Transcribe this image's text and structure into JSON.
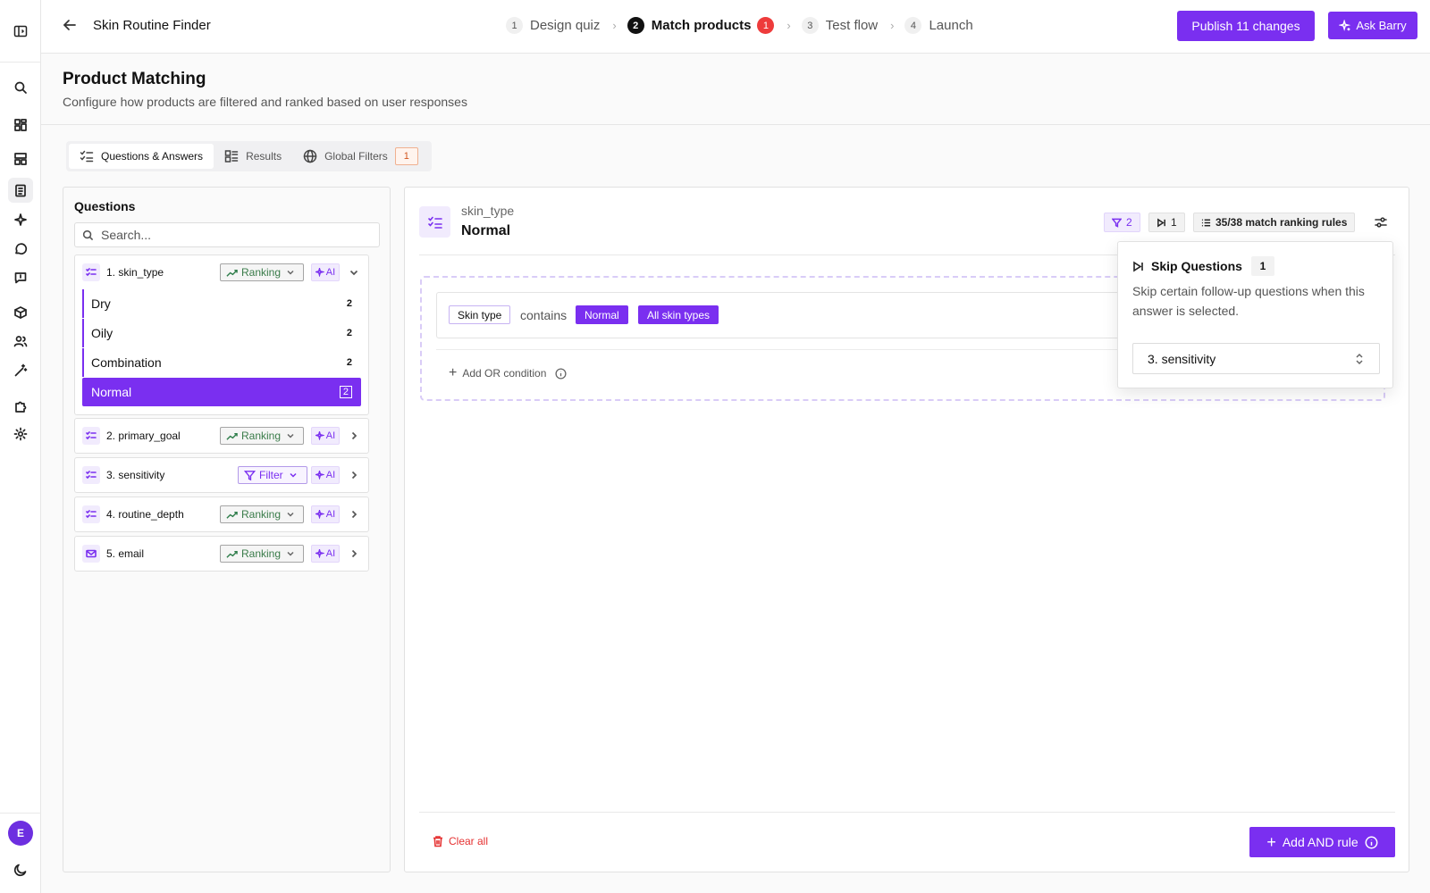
{
  "app": {
    "title": "Skin Routine Finder"
  },
  "steps": [
    {
      "num": "1",
      "label": "Design quiz"
    },
    {
      "num": "2",
      "label": "Match products",
      "badge": "1"
    },
    {
      "num": "3",
      "label": "Test flow"
    },
    {
      "num": "4",
      "label": "Launch"
    }
  ],
  "header": {
    "publish_label": "Publish 11 changes",
    "ask_label": "Ask Barry"
  },
  "page": {
    "title": "Product Matching",
    "subtitle": "Configure how products are filtered and ranked based on user responses"
  },
  "tabs": [
    {
      "label": "Questions & Answers"
    },
    {
      "label": "Results"
    },
    {
      "label": "Global Filters",
      "count": "1"
    }
  ],
  "questions_panel": {
    "title": "Questions",
    "search_placeholder": "Search...",
    "questions": [
      {
        "label": "1. skin_type",
        "mode": "Ranking",
        "ai": "AI",
        "icon": "checklist-icon"
      },
      {
        "label": "2. primary_goal",
        "mode": "Ranking",
        "ai": "AI",
        "icon": "checklist-icon"
      },
      {
        "label": "3. sensitivity",
        "mode": "Filter",
        "ai": "AI",
        "icon": "checklist-icon"
      },
      {
        "label": "4. routine_depth",
        "mode": "Ranking",
        "ai": "AI",
        "icon": "checklist-icon"
      },
      {
        "label": "5. email",
        "mode": "Ranking",
        "ai": "AI",
        "icon": "mail-icon"
      }
    ],
    "answers": [
      {
        "label": "Dry",
        "count": "2"
      },
      {
        "label": "Oily",
        "count": "2"
      },
      {
        "label": "Combination",
        "count": "2"
      },
      {
        "label": "Normal",
        "count": "2"
      }
    ]
  },
  "main": {
    "question_key": "skin_type",
    "answer": "Normal",
    "filter_count": "2",
    "skip_count": "1",
    "ranking_rules": "35/38 match ranking rules",
    "rule": {
      "attribute": "Skin type",
      "operator": "contains",
      "values": [
        "Normal",
        "All skin types"
      ]
    },
    "add_or_label": "Add OR condition",
    "clear_all_label": "Clear all",
    "add_and_label": "Add AND rule"
  },
  "popover": {
    "title": "Skip Questions",
    "count": "1",
    "description": "Skip certain follow-up questions when this answer is selected.",
    "selected_option": "3. sensitivity"
  },
  "user": {
    "initial": "E"
  },
  "colors": {
    "accent": "#7a2ff0",
    "danger": "#e53030",
    "ranking": "#2e7d4a"
  }
}
